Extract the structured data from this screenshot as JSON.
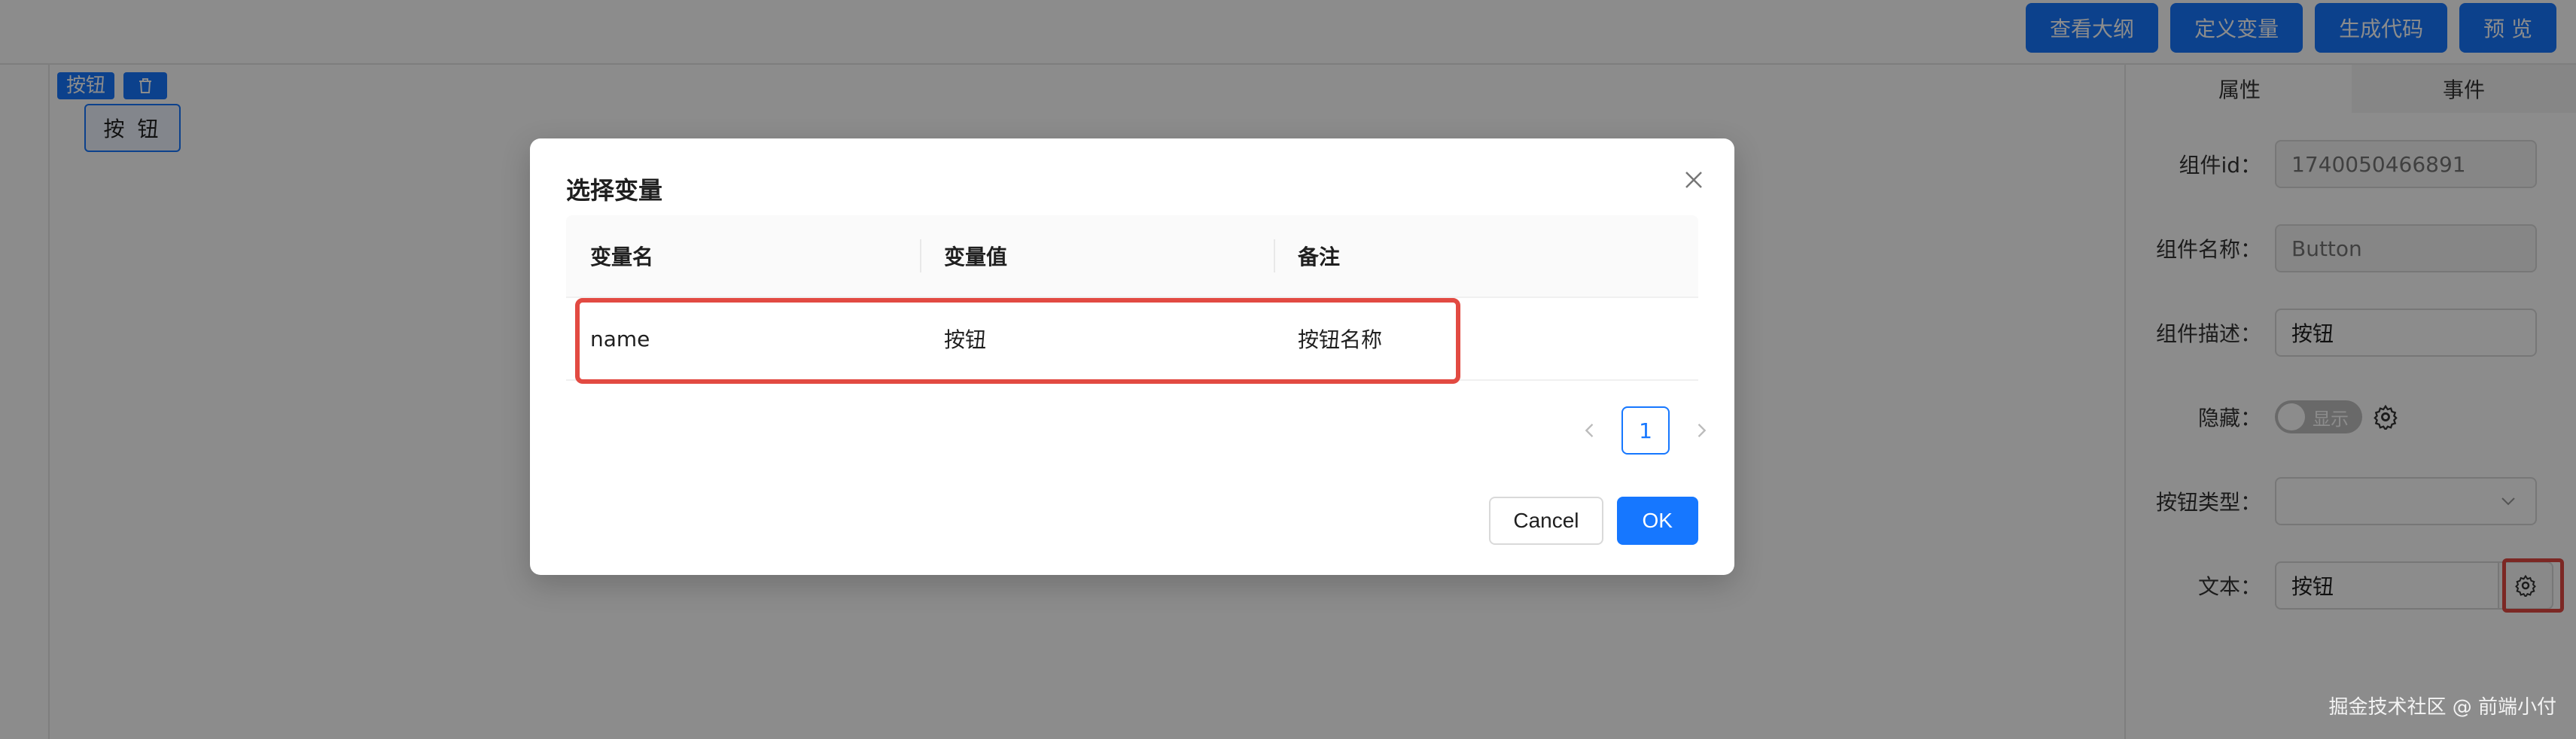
{
  "header": {
    "actions": [
      "查看大纲",
      "定义变量",
      "生成代码",
      "预 览"
    ]
  },
  "canvas": {
    "selection_toolbar": {
      "label": "按钮",
      "delete_icon": "trash-icon"
    },
    "button_text": "按 钮"
  },
  "right_panel": {
    "tabs": [
      "属性",
      "事件"
    ],
    "active_tab": "属性",
    "fields": {
      "component_id": {
        "label": "组件id：",
        "value": "1740050466891"
      },
      "component_name": {
        "label": "组件名称：",
        "value": "Button"
      },
      "component_desc": {
        "label": "组件描述：",
        "value": "按钮"
      },
      "hidden": {
        "label": "隐藏：",
        "toggle_text": "显示"
      },
      "button_type": {
        "label": "按钮类型：",
        "value": ""
      },
      "text": {
        "label": "文本：",
        "value": "按钮"
      }
    }
  },
  "modal": {
    "title": "选择变量",
    "columns": [
      "变量名",
      "变量值",
      "备注"
    ],
    "rows": [
      {
        "name": "name",
        "value": "按钮",
        "note": "按钮名称"
      }
    ],
    "pagination": {
      "current": "1"
    },
    "cancel_label": "Cancel",
    "ok_label": "OK"
  },
  "watermark": "掘金技术社区 @ 前端小付",
  "colors": {
    "primary": "#1677ff",
    "highlight": "#e24a42"
  }
}
